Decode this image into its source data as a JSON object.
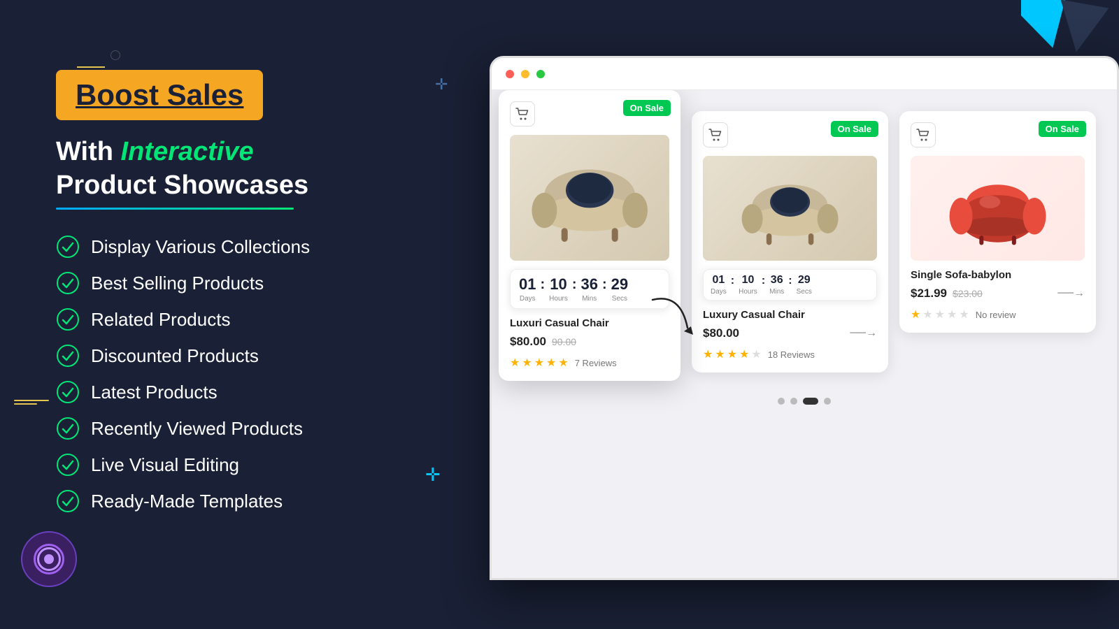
{
  "page": {
    "background_color": "#1a2035"
  },
  "hero": {
    "badge": "Boost Sales",
    "headline_before": "With",
    "headline_interactive": "Interactive",
    "headline_after": "Product Showcases"
  },
  "features": [
    {
      "id": 1,
      "label": "Display Various Collections"
    },
    {
      "id": 2,
      "label": "Best Selling Products"
    },
    {
      "id": 3,
      "label": "Related Products"
    },
    {
      "id": 4,
      "label": "Discounted Products"
    },
    {
      "id": 5,
      "label": "Latest Products"
    },
    {
      "id": 6,
      "label": "Recently Viewed Products"
    },
    {
      "id": 7,
      "label": "Live Visual Editing"
    },
    {
      "id": 8,
      "label": "Ready-Made Templates"
    }
  ],
  "products": {
    "featured": {
      "on_sale_label": "On Sale",
      "name": "Luxuri Casual Chair",
      "price": "$80.00",
      "price_old": "90.00",
      "stars": 5,
      "reviews": "7 Reviews",
      "countdown": {
        "days_num": "01",
        "days_label": "Days",
        "hours_num": "10",
        "hours_label": "Hours",
        "mins_num": "36",
        "mins_label": "Mins",
        "secs_num": "29",
        "secs_label": "Secs"
      }
    },
    "middle": {
      "on_sale_label": "On Sale",
      "name": "Luxury Casual Chair",
      "price": "$80.00",
      "stars": 4,
      "reviews": "18 Reviews",
      "countdown": {
        "days_num": "01",
        "days_label": "Days",
        "hours_num": "10",
        "hours_label": "Hours",
        "mins_num": "36",
        "mins_label": "Mins",
        "secs_num": "29",
        "secs_label": "Secs"
      }
    },
    "right": {
      "on_sale_label": "On Sale",
      "name": "Single Sofa-babylon",
      "price": "$21.99",
      "price_old": "$23.00",
      "stars": 1,
      "no_review": "No review"
    }
  },
  "pagination": {
    "dots": 4,
    "active_index": 2
  },
  "icons": {
    "cart": "🛒",
    "check": "✔",
    "star_full": "★",
    "star_empty": "☆"
  },
  "colors": {
    "accent_green": "#00e676",
    "accent_blue": "#00aaff",
    "badge_orange": "#f5a623",
    "on_sale_green": "#00c853",
    "star_gold": "#ffb300",
    "bg_dark": "#1a2035"
  }
}
